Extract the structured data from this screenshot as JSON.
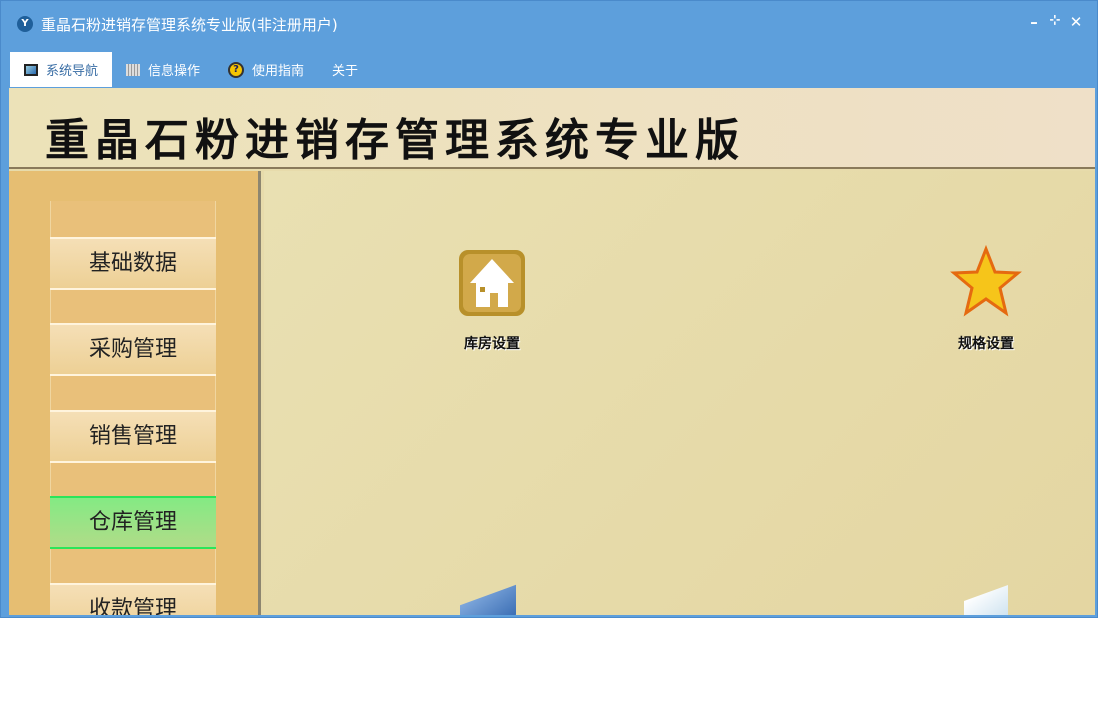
{
  "window": {
    "title": "重晶石粉进销存管理系统专业版(非注册用户)",
    "app_icon": "yf-logo-icon",
    "controls": [
      "minimize-icon",
      "restore-icon",
      "close-icon"
    ]
  },
  "tabs": [
    {
      "label": "系统导航",
      "icon": "monitor-icon"
    },
    {
      "label": "信息操作",
      "icon": "grid-icon"
    },
    {
      "label": "使用指南",
      "icon": "help-icon"
    },
    {
      "label": "关于"
    }
  ],
  "banner": {
    "title": "重晶石粉进销存管理系统专业版"
  },
  "sidebar": {
    "items": [
      {
        "label": "基础数据"
      },
      {
        "label": "采购管理"
      },
      {
        "label": "销售管理"
      },
      {
        "label": "仓库管理",
        "active": true
      },
      {
        "label": "收款管理"
      }
    ]
  },
  "main": {
    "items": [
      {
        "label": "库房设置",
        "icon": "house-icon"
      },
      {
        "label": "规格设置",
        "icon": "star-icon"
      }
    ]
  },
  "colors": {
    "titlebar": "#5d9fdc",
    "active_nav": "#84ea84",
    "sidebar": "#e6be72"
  }
}
